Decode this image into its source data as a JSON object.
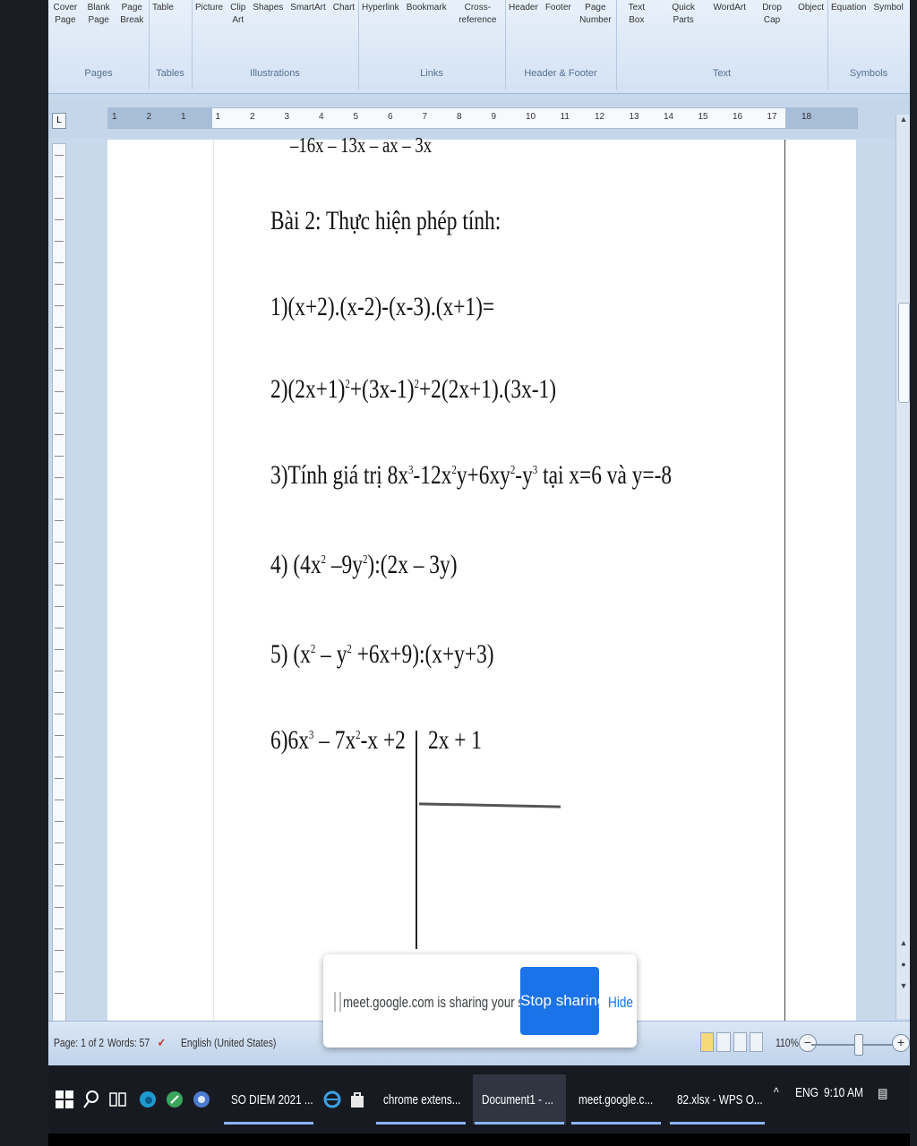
{
  "ribbon": {
    "groups": [
      {
        "name": "Pages",
        "items": [
          "Cover Page",
          "Blank Page",
          "Page Break"
        ]
      },
      {
        "name": "Tables",
        "items": [
          "Table"
        ]
      },
      {
        "name": "Illustrations",
        "items": [
          "Picture",
          "Clip Art",
          "Shapes",
          "SmartArt",
          "Chart"
        ]
      },
      {
        "name": "Links",
        "items": [
          "Hyperlink",
          "Bookmark",
          "Cross-reference"
        ]
      },
      {
        "name": "Header & Footer",
        "items": [
          "Header",
          "Footer",
          "Page Number"
        ]
      },
      {
        "name": "Text",
        "items": [
          "Text Box",
          "Quick Parts",
          "WordArt",
          "Drop Cap",
          "Object"
        ]
      },
      {
        "name": "Symbols",
        "items": [
          "Equation",
          "Symbol"
        ]
      }
    ]
  },
  "ruler": {
    "ticks": [
      "1",
      "2",
      "1",
      "1",
      "2",
      "3",
      "4",
      "5",
      "6",
      "7",
      "8",
      "9",
      "10",
      "11",
      "12",
      "13",
      "14",
      "15",
      "16",
      "17",
      "18"
    ]
  },
  "document": {
    "cut_line": "–16x – 13x – ax – 3x",
    "title": "Bài 2: Thực hiện phép tính:",
    "q1": "1)(x+2).(x-2)-(x-3).(x+1)=",
    "q2_a": "2)(2x+1)",
    "q2_b": "2",
    "q2_c": "+(3x-1)",
    "q2_d": "2",
    "q2_e": "+2(2x+1).(3x-1)",
    "q3_a": "3)Tính giá trị 8x",
    "q3_b": "3",
    "q3_c": "-12x",
    "q3_d": "2",
    "q3_e": "y+6xy",
    "q3_f": "2",
    "q3_g": "-y",
    "q3_h": "3",
    "q3_i": " tại x=6 và y=-8",
    "q4_a": "4) (4x",
    "q4_b": "2",
    "q4_c": " –9y",
    "q4_d": "2",
    "q4_e": "):(2x – 3y)",
    "q5_a": "5) (x",
    "q5_b": "2",
    "q5_c": " – y",
    "q5_d": "2",
    "q5_e": " +6x+9):(x+y+3)",
    "q6_a": "6)6x",
    "q6_b": "3",
    "q6_c": " – 7x",
    "q6_d": "2",
    "q6_e": "-x +2",
    "divisor": "2x + 1"
  },
  "statusbar": {
    "page": "Page: 1 of 2",
    "words": "Words: 57",
    "language": "English (United States)",
    "zoom": "110%",
    "zoom_level": 0.55
  },
  "share": {
    "message": "meet.google.com is sharing your screen.",
    "stop_label": "Stop sharing",
    "hide_label": "Hide"
  },
  "taskbar": {
    "apps": [
      {
        "label": "SO DIEM 2021 ...",
        "icon": "folder-icon",
        "color": "#f2c14e"
      },
      {
        "label": "chrome extens...",
        "icon": "chrome-icon",
        "color": "#e94235"
      },
      {
        "label": "Document1 - ...",
        "icon": "word-icon",
        "color": "#2b5797"
      },
      {
        "label": "meet.google.c...",
        "icon": "chrome-icon",
        "color": "#e94235"
      },
      {
        "label": "82.xlsx - WPS O...",
        "icon": "wps-icon",
        "color": "#c9302c"
      }
    ],
    "lang": "ENG",
    "time": "9:10 AM"
  }
}
